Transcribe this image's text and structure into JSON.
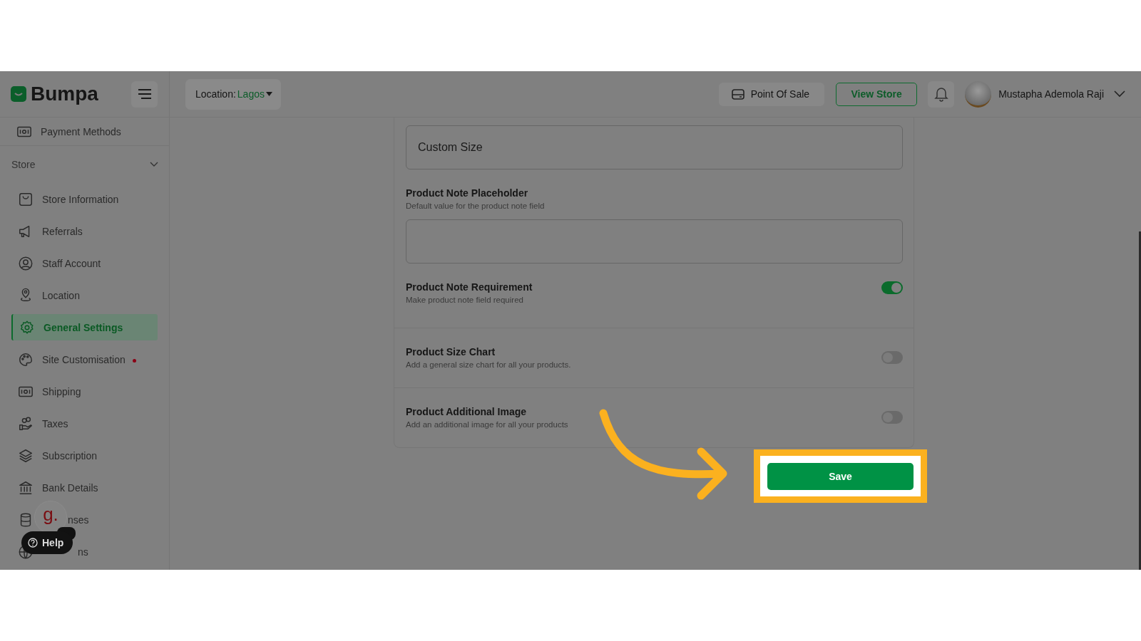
{
  "header": {
    "logo": "Bumpa",
    "location_label": "Location:",
    "location_value": "Lagos",
    "point_of_sale": "Point Of Sale",
    "view_store": "View Store",
    "user_name": "Mustapha Ademola Raji"
  },
  "sidebar": {
    "top_item": {
      "label": "Payment Methods"
    },
    "section": {
      "title": "Store",
      "expanded": true
    },
    "items": [
      {
        "label": "Store Information",
        "selected": false,
        "dot": false
      },
      {
        "label": "Referrals",
        "selected": false,
        "dot": false
      },
      {
        "label": "Staff Account",
        "selected": false,
        "dot": false
      },
      {
        "label": "Location",
        "selected": false,
        "dot": false
      },
      {
        "label": "General Settings",
        "selected": true,
        "dot": false
      },
      {
        "label": "Site Customisation",
        "selected": false,
        "dot": true
      },
      {
        "label": "Shipping",
        "selected": false,
        "dot": false
      },
      {
        "label": "Taxes",
        "selected": false,
        "dot": false
      },
      {
        "label": "Subscription",
        "selected": false,
        "dot": false
      },
      {
        "label": "Bank Details",
        "selected": false,
        "dot": false
      },
      {
        "label": "nses",
        "selected": false,
        "dot": false
      },
      {
        "label": "ns",
        "selected": false,
        "dot": false
      }
    ]
  },
  "help_widget": {
    "logo": "g.",
    "label": "Help"
  },
  "form": {
    "size_field": {
      "value": "Custom Size"
    },
    "note_placeholder": {
      "title": "Product Note Placeholder",
      "subtitle": "Default value for the product note field"
    },
    "toggles": [
      {
        "title": "Product Note Requirement",
        "subtitle": "Make product note field required",
        "on": true
      },
      {
        "title": "Product Size Chart",
        "subtitle": "Add a general size chart for all your products.",
        "on": false
      },
      {
        "title": "Product Additional Image",
        "subtitle": "Add an additional image for all your products",
        "on": false
      }
    ]
  },
  "save_button": {
    "label": "Save"
  }
}
